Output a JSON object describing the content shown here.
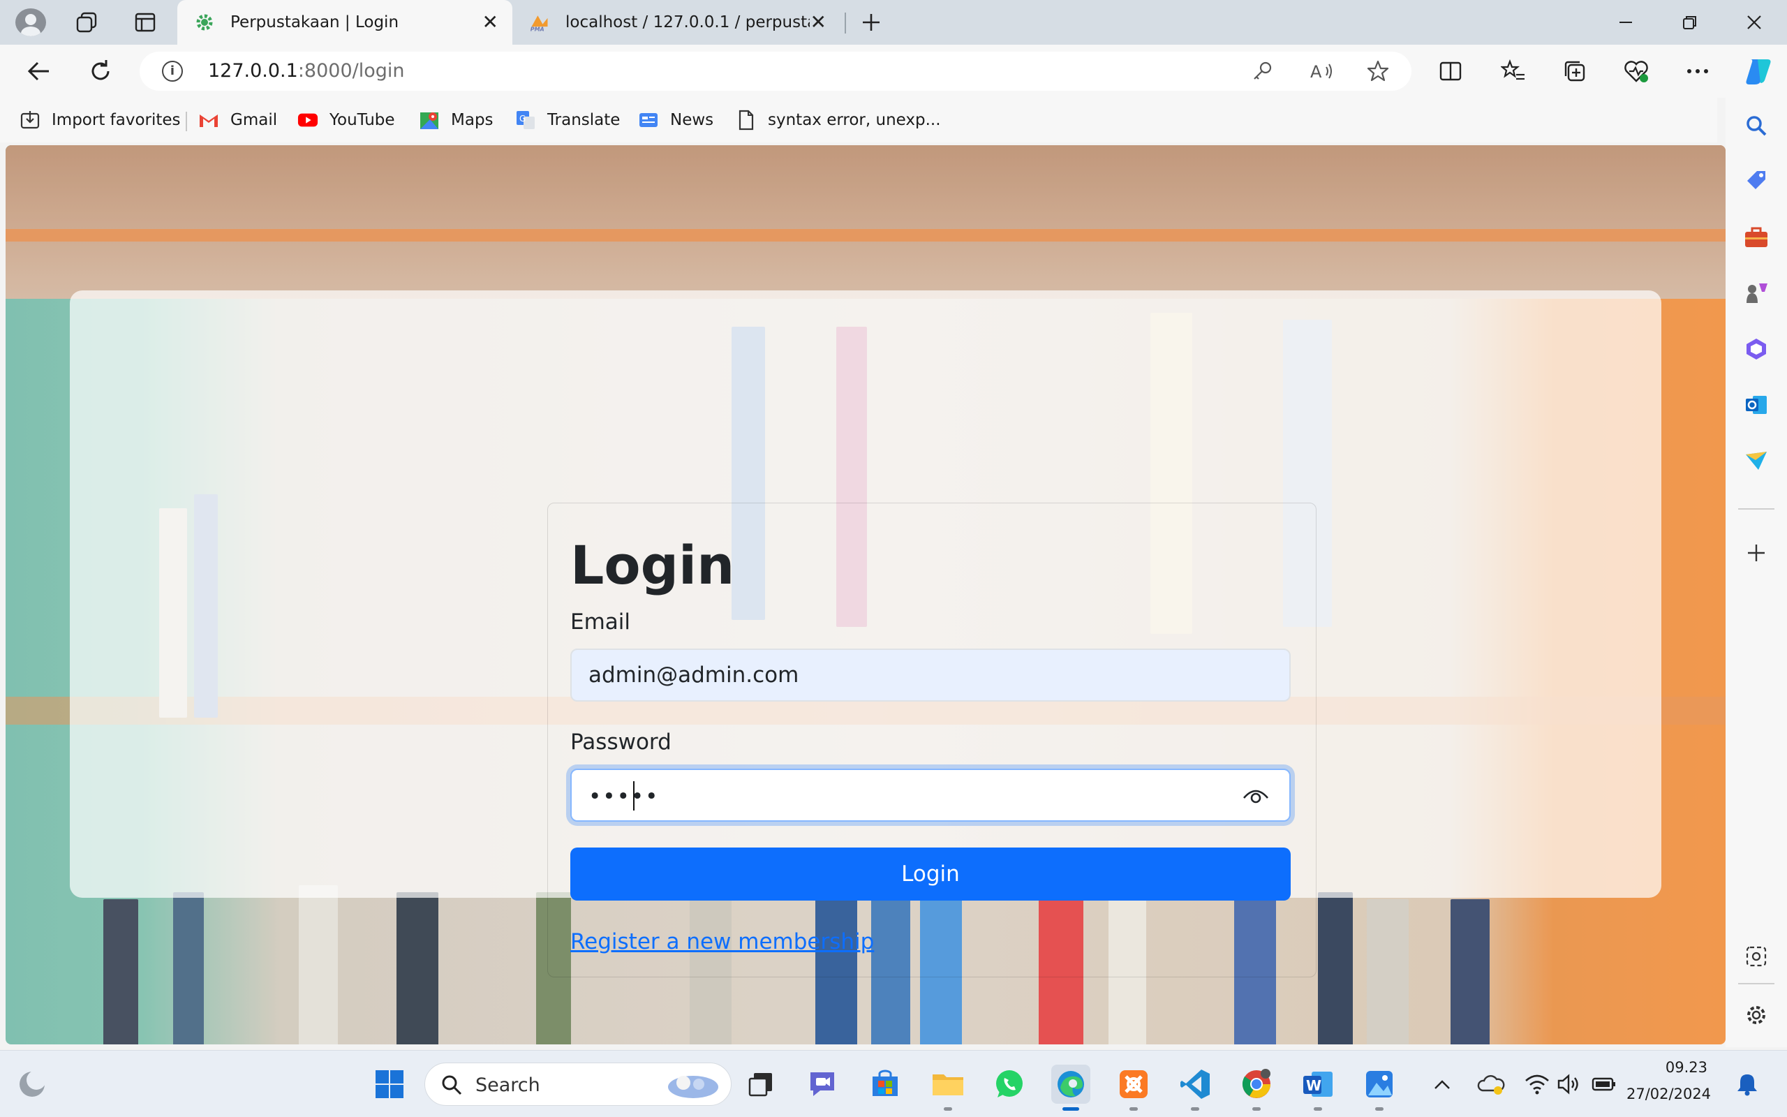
{
  "browser": {
    "tabs": [
      {
        "title": "Perpustakaan | Login",
        "active": true
      },
      {
        "title": "localhost / 127.0.0.1 / perpustaka",
        "active": false
      }
    ],
    "address": {
      "host": "127.0.0.1",
      "rest": ":8000/login"
    },
    "favorites": [
      {
        "label": "Import favorites",
        "icon": "import-icon"
      },
      {
        "label": "Gmail",
        "icon": "gmail-icon"
      },
      {
        "label": "YouTube",
        "icon": "youtube-icon"
      },
      {
        "label": "Maps",
        "icon": "maps-icon"
      },
      {
        "label": "Translate",
        "icon": "translate-icon"
      },
      {
        "label": "News",
        "icon": "news-icon"
      },
      {
        "label": "syntax error, unexp...",
        "icon": "page-icon"
      }
    ]
  },
  "login": {
    "title": "Login",
    "email_label": "Email",
    "email_value": "admin@admin.com",
    "password_label": "Password",
    "password_mask": "•••••",
    "button_label": "Login",
    "register_link": "Register a new membership"
  },
  "taskbar": {
    "search_label": "Search",
    "time": "09.23",
    "date": "27/02/2024"
  },
  "colors": {
    "primary": "#0d6efd",
    "autofill": "#e8f0fe",
    "tab_strip": "#d6dde4"
  }
}
